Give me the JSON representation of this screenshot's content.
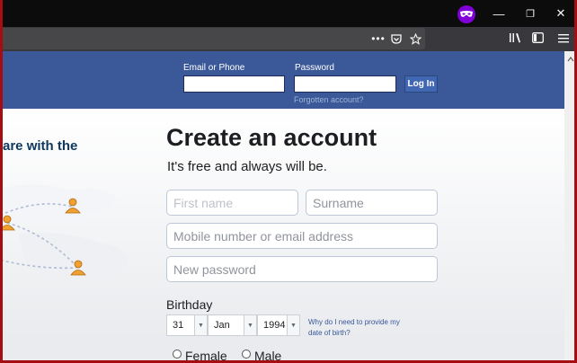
{
  "window": {
    "controls": {
      "minimize": "—",
      "restore": "❐",
      "close": "✕"
    }
  },
  "toolbar": {
    "page_actions_icon": "dots-icon",
    "pocket_icon": "pocket-icon",
    "bookmark_icon": "star-icon",
    "library_icon": "library-icon",
    "sidebar_icon": "sidebar-icon",
    "menu_icon": "hamburger-menu-icon"
  },
  "login": {
    "email_label": "Email or Phone",
    "password_label": "Password",
    "button_label": "Log In",
    "forgot_link": "Forgotten account?"
  },
  "left": {
    "share_text": "are with the"
  },
  "signup": {
    "heading": "Create an account",
    "subheading": "It's free and always will be.",
    "first_name_placeholder": "First name",
    "surname_placeholder": "Surname",
    "mobile_placeholder": "Mobile number or email address",
    "password_placeholder": "New password",
    "birthday_label": "Birthday",
    "day": "31",
    "month": "Jan",
    "year": "1994",
    "why_link": "Why do I need to provide my date of birth?",
    "female_label": "Female",
    "male_label": "Male"
  },
  "colors": {
    "brand": "#3b5998",
    "private_badge": "#8000d7",
    "frame_border": "#a40e12"
  }
}
